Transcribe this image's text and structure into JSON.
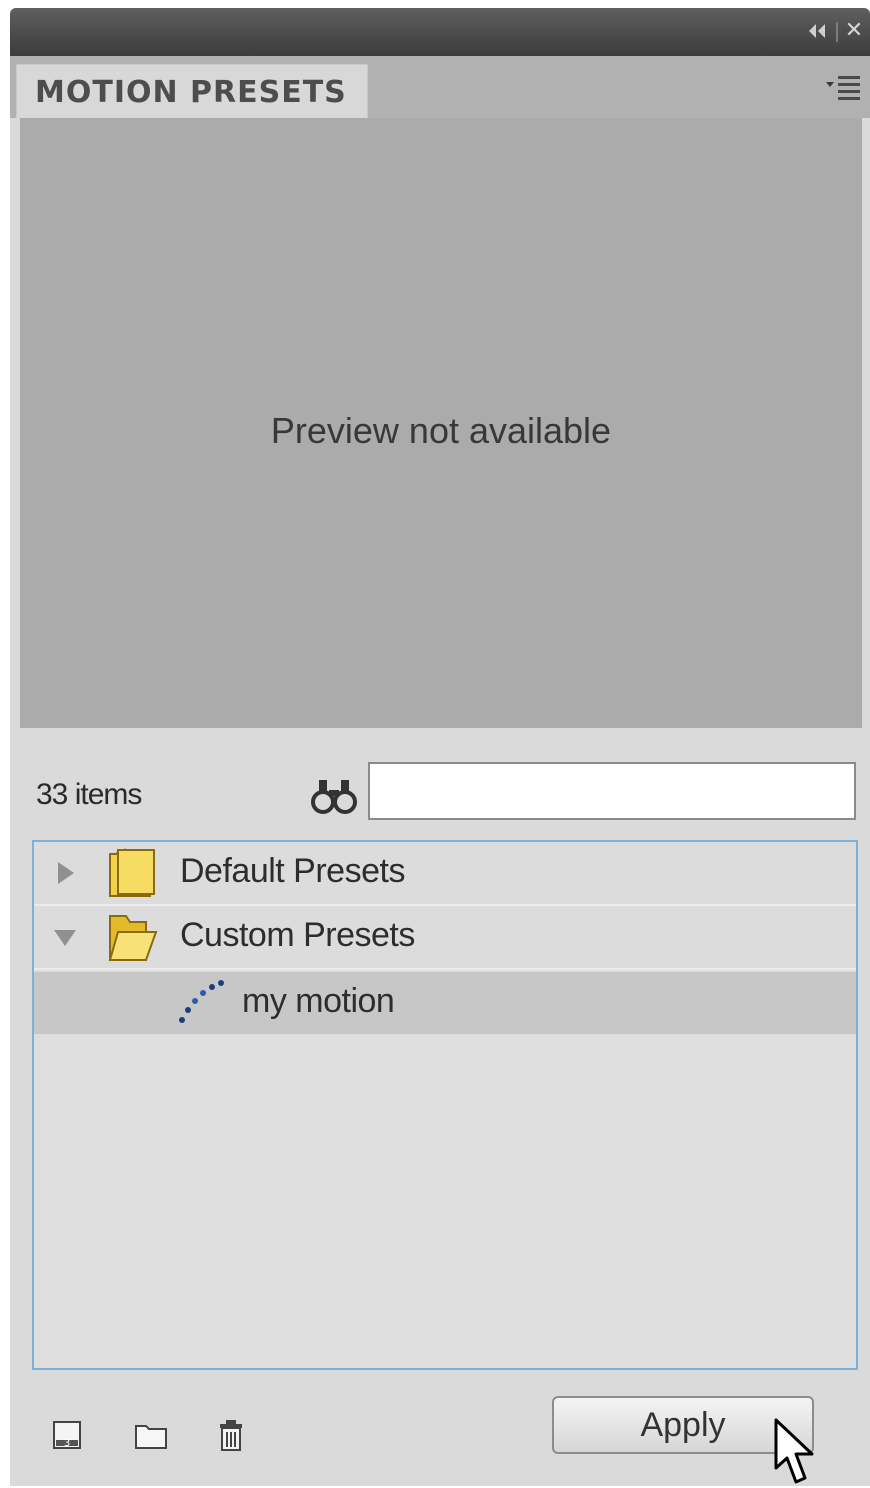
{
  "panel": {
    "title": "MOTION PRESETS",
    "preview_text": "Preview not available",
    "item_count": "33 items",
    "search": {
      "value": "",
      "placeholder": ""
    }
  },
  "tree": [
    {
      "label": "Default Presets",
      "type": "folder",
      "expanded": false
    },
    {
      "label": "Custom Presets",
      "type": "folder",
      "expanded": true
    },
    {
      "label": "my motion",
      "type": "preset",
      "selected": true
    }
  ],
  "buttons": {
    "apply": "Apply"
  },
  "icons": {
    "titlebar": [
      "collapse-icon",
      "close-icon"
    ],
    "tab": [
      "panel-menu-icon"
    ],
    "search": "binoculars-icon",
    "bottom": [
      "import-preset-icon",
      "new-folder-icon",
      "delete-icon"
    ],
    "cursor": "mouse-cursor-icon"
  },
  "colors": {
    "selection_row": "#c7c7c7",
    "tree_border": "#7eb0dc",
    "folder": "#f2d049"
  }
}
